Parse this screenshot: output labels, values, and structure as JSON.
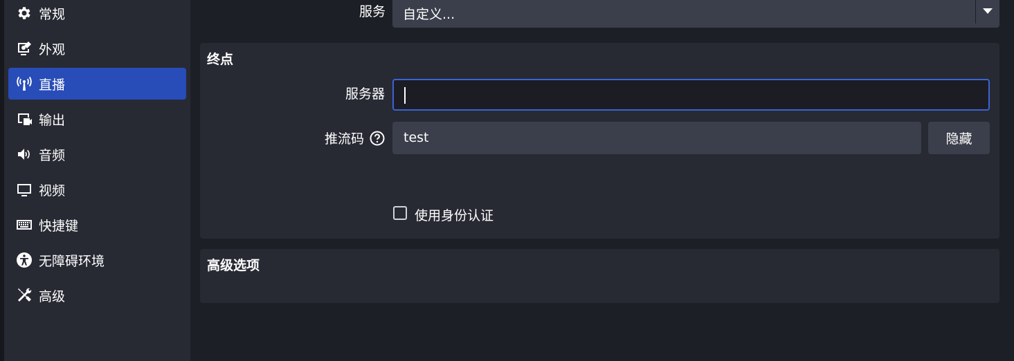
{
  "sidebar": {
    "items": [
      {
        "label": "常规",
        "icon": "gear-icon"
      },
      {
        "label": "外观",
        "icon": "appearance-icon"
      },
      {
        "label": "直播",
        "icon": "broadcast-antenna-icon",
        "selected": true
      },
      {
        "label": "输出",
        "icon": "output-icon"
      },
      {
        "label": "音频",
        "icon": "speaker-icon"
      },
      {
        "label": "视频",
        "icon": "monitor-icon"
      },
      {
        "label": "快捷键",
        "icon": "keyboard-icon"
      },
      {
        "label": "无障碍环境",
        "icon": "accessibility-icon"
      },
      {
        "label": "高级",
        "icon": "tools-icon"
      }
    ]
  },
  "service": {
    "label": "服务",
    "value": "自定义..."
  },
  "endpoint": {
    "title": "终点",
    "server_label": "服务器",
    "server_value": "",
    "key_label": "推流码",
    "key_value": "test",
    "hide_button": "隐藏",
    "auth_label": "使用身份认证",
    "auth_checked": false
  },
  "advanced": {
    "title": "高级选项"
  },
  "colors": {
    "accent": "#284cb8",
    "focus_border": "#3b63d3",
    "panel": "#272a33",
    "background": "#1d1f26",
    "control": "#3b3e4b"
  }
}
